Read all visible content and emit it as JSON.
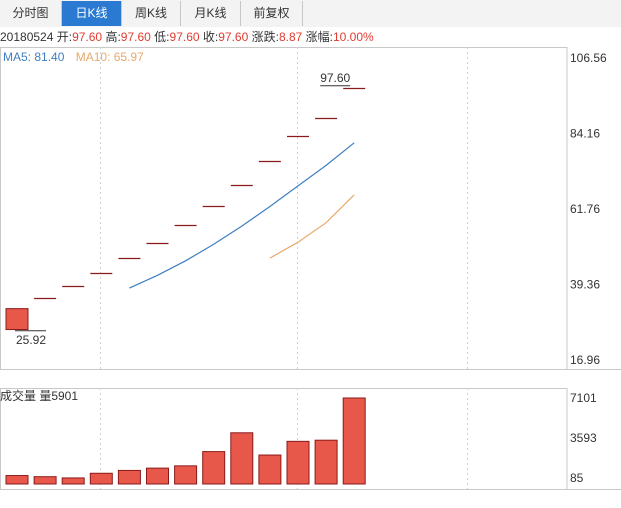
{
  "tabs": [
    {
      "label": "分时图",
      "active": false
    },
    {
      "label": "日K线",
      "active": true
    },
    {
      "label": "周K线",
      "active": false
    },
    {
      "label": "月K线",
      "active": false
    },
    {
      "label": "前复权",
      "active": false
    }
  ],
  "info": {
    "date": "20180524",
    "open_label": "开:",
    "open": "97.60",
    "high_label": "高:",
    "high": "97.60",
    "low_label": "低:",
    "low": "97.60",
    "close_label": "收:",
    "close": "97.60",
    "change_label": "涨跌:",
    "change": "8.87",
    "pct_label": "涨幅:",
    "pct": "10.00%"
  },
  "ma": {
    "ma5": "MA5: 81.40",
    "ma10": "MA10: 65.97"
  },
  "volume_title": "成交量 量5901",
  "colors": {
    "up": "#e8584a",
    "candle_line": "#8b1a1a",
    "ma5": "#3f7fc0",
    "ma10": "#e8a96a",
    "tab_active": "#2a7ad1",
    "info_value": "#e03c31"
  },
  "chart_data": {
    "type": "candlestick",
    "price_axis": {
      "ticks": [
        "106.56",
        "84.16",
        "61.76",
        "39.36",
        "16.96"
      ],
      "range": [
        16.96,
        106.56
      ]
    },
    "volume_axis": {
      "ticks": [
        "7101",
        "3593",
        "85"
      ],
      "range": [
        85,
        7101
      ]
    },
    "candles": [
      {
        "open": 26.0,
        "high": 32.2,
        "low": 25.92,
        "close": 32.2
      },
      {
        "open": 35.4,
        "high": 35.4,
        "low": 35.4,
        "close": 35.4
      },
      {
        "open": 38.9,
        "high": 38.9,
        "low": 38.9,
        "close": 38.9
      },
      {
        "open": 42.8,
        "high": 42.8,
        "low": 42.8,
        "close": 42.8
      },
      {
        "open": 47.1,
        "high": 47.1,
        "low": 47.1,
        "close": 47.1
      },
      {
        "open": 51.8,
        "high": 51.8,
        "low": 51.8,
        "close": 51.8
      },
      {
        "open": 57.0,
        "high": 57.0,
        "low": 57.0,
        "close": 57.0
      },
      {
        "open": 62.7,
        "high": 62.7,
        "low": 62.7,
        "close": 62.7
      },
      {
        "open": 69.0,
        "high": 69.0,
        "low": 69.0,
        "close": 69.0
      },
      {
        "open": 75.9,
        "high": 75.9,
        "low": 75.9,
        "close": 75.9
      },
      {
        "open": 83.5,
        "high": 83.5,
        "low": 83.5,
        "close": 83.5
      },
      {
        "open": 88.7,
        "high": 88.7,
        "low": 88.7,
        "close": 88.7
      },
      {
        "open": 97.6,
        "high": 97.6,
        "low": 97.6,
        "close": 97.6
      }
    ],
    "ma5": [
      null,
      null,
      null,
      null,
      38.3,
      42.1,
      46.4,
      51.3,
      56.7,
      62.5,
      68.6,
      74.7,
      81.4
    ],
    "ma10": [
      null,
      null,
      null,
      null,
      null,
      null,
      null,
      null,
      null,
      47.2,
      51.9,
      57.7,
      65.97
    ],
    "volume": [
      300,
      200,
      90,
      500,
      750,
      950,
      1150,
      2400,
      4050,
      2100,
      3300,
      3400,
      7101
    ],
    "annotations": {
      "max_label": "97.60",
      "min_label": "25.92"
    }
  }
}
